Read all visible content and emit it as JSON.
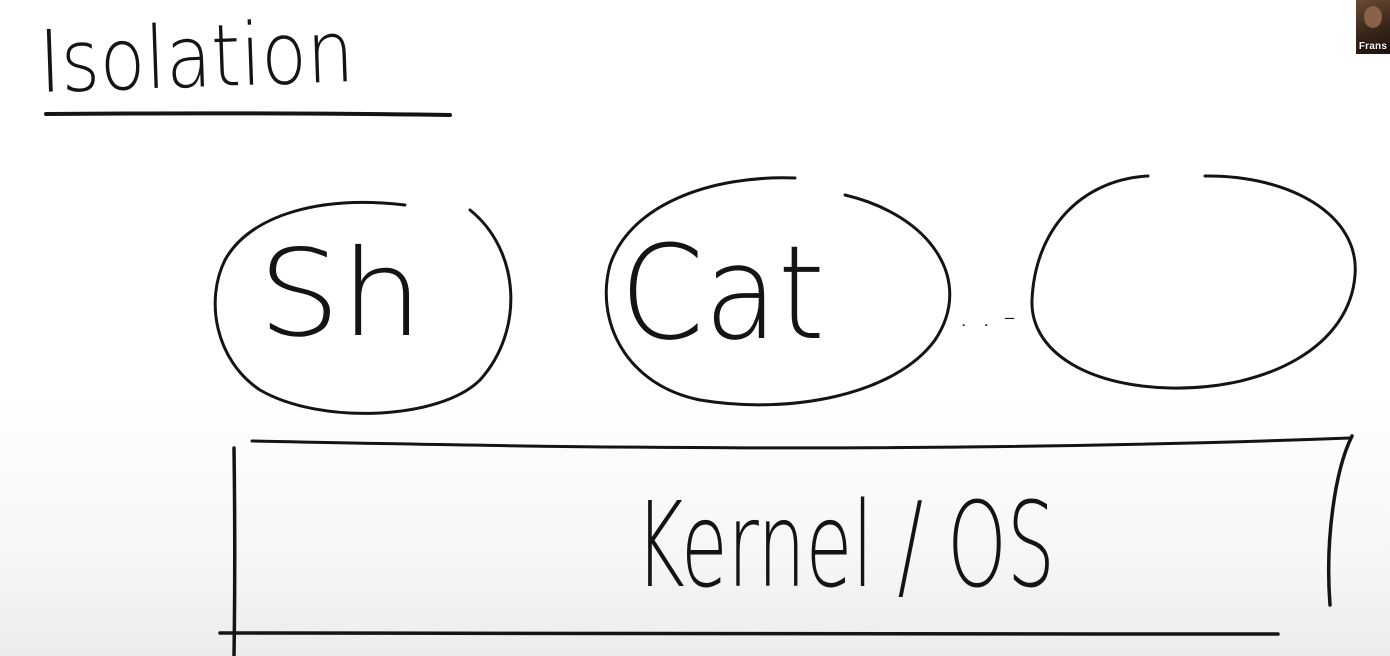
{
  "title": "Isolation",
  "processes": [
    {
      "label": "Sh"
    },
    {
      "label": "Cat"
    },
    {
      "label": ""
    }
  ],
  "ellipsis": ". . -",
  "kernel_label": "Kernel / OS",
  "webcam": {
    "name": "Frans"
  },
  "colors": {
    "ink": "#141414",
    "background": "#ffffff"
  }
}
